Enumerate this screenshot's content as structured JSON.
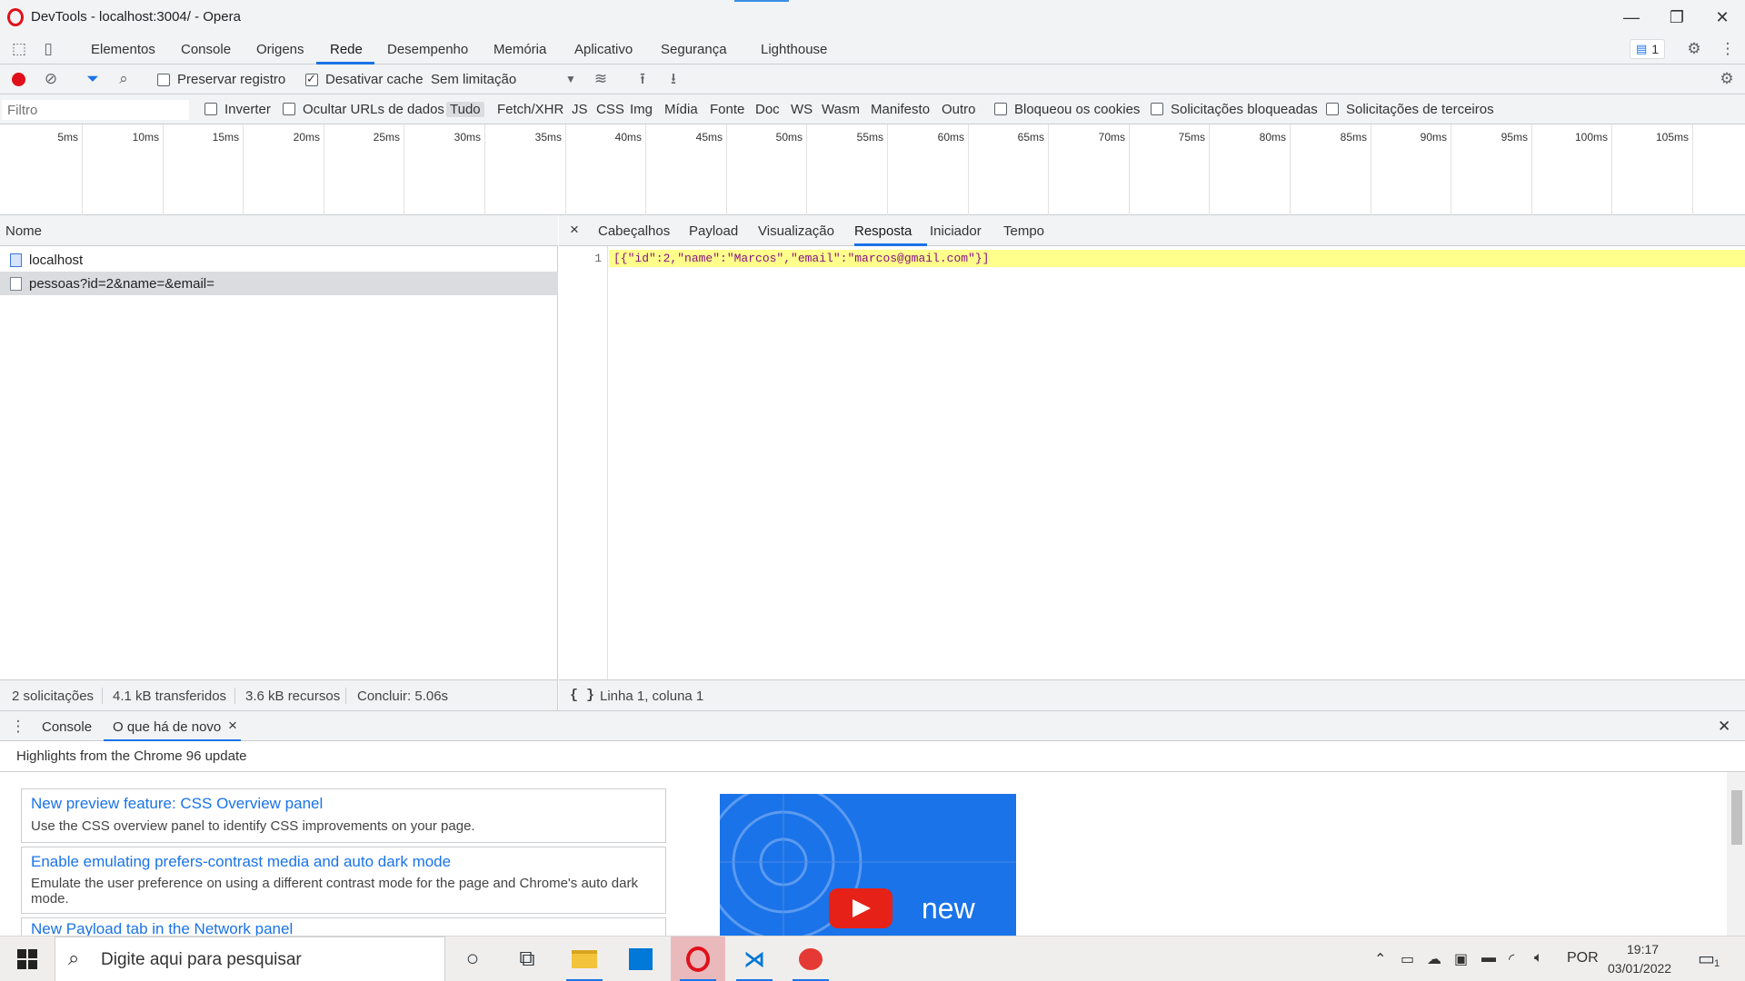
{
  "window": {
    "title": "DevTools - localhost:3004/ - Opera",
    "minimize_glyph": "—",
    "restore_glyph": "❐",
    "close_glyph": "✕"
  },
  "main_tabs": [
    "Elementos",
    "Console",
    "Origens",
    "Rede",
    "Desempenho",
    "Memória",
    "Aplicativo",
    "Segurança",
    "Lighthouse"
  ],
  "issues_badge": "1",
  "network_toolbar": {
    "preserve_log": "Preservar registro",
    "disable_cache": "Desativar cache",
    "throttling": "Sem limitação"
  },
  "filter_bar": {
    "placeholder": "Filtro",
    "invert": "Inverter",
    "hide_data_urls": "Ocultar URLs de dados",
    "types": [
      "Tudo",
      "Fetch/XHR",
      "JS",
      "CSS",
      "Img",
      "Mídia",
      "Fonte",
      "Doc",
      "WS",
      "Wasm",
      "Manifesto",
      "Outro"
    ],
    "blocked_cookies": "Bloqueou os cookies",
    "blocked_requests": "Solicitações bloqueadas",
    "third_party": "Solicitações de terceiros"
  },
  "timeline_ticks": [
    "5ms",
    "10ms",
    "15ms",
    "20ms",
    "25ms",
    "30ms",
    "35ms",
    "40ms",
    "45ms",
    "50ms",
    "55ms",
    "60ms",
    "65ms",
    "70ms",
    "75ms",
    "80ms",
    "85ms",
    "90ms",
    "95ms",
    "100ms",
    "105ms",
    "1"
  ],
  "requests": {
    "column_header": "Nome",
    "rows": [
      "localhost",
      "pessoas?id=2&name=&email="
    ]
  },
  "status_left": {
    "requests": "2 solicitações",
    "transferred": "4.1 kB transferidos",
    "resources": "3.6 kB recursos",
    "finish": "Concluir: 5.06s"
  },
  "detail": {
    "close_glyph": "×",
    "tabs": [
      "Cabeçalhos",
      "Payload",
      "Visualização",
      "Resposta",
      "Iniciador",
      "Tempo"
    ],
    "active_tab": "Resposta",
    "line_number": "1",
    "response": "[{\"id\":2,\"name\":\"Marcos\",\"email\":\"marcos@gmail.com\"}]",
    "pretty_print": "{ }",
    "position": "Linha 1, coluna 1"
  },
  "drawer": {
    "tabs": [
      "Console",
      "O que há de novo"
    ],
    "tab_close": "×",
    "close": "✕",
    "header": "Highlights from the Chrome 96 update",
    "cards": [
      {
        "title": "New preview feature: CSS Overview panel",
        "desc": "Use the CSS overview panel to identify CSS improvements on your page."
      },
      {
        "title": "Enable emulating prefers-contrast media and auto dark mode",
        "desc": "Emulate the user preference on using a different contrast mode for the page and Chrome's auto dark mode."
      },
      {
        "title": "New Payload tab in the Network panel",
        "desc": ""
      }
    ],
    "video_text": "new"
  },
  "taskbar": {
    "search_placeholder": "Digite aqui para pesquisar",
    "language": "POR",
    "time": "19:17",
    "date": "03/01/2022",
    "notifications": "1"
  },
  "colors": {
    "accent": "#1a73e8",
    "record": "#e0101a",
    "opera": "#e0101a",
    "response_highlight": "#ffff8c"
  }
}
